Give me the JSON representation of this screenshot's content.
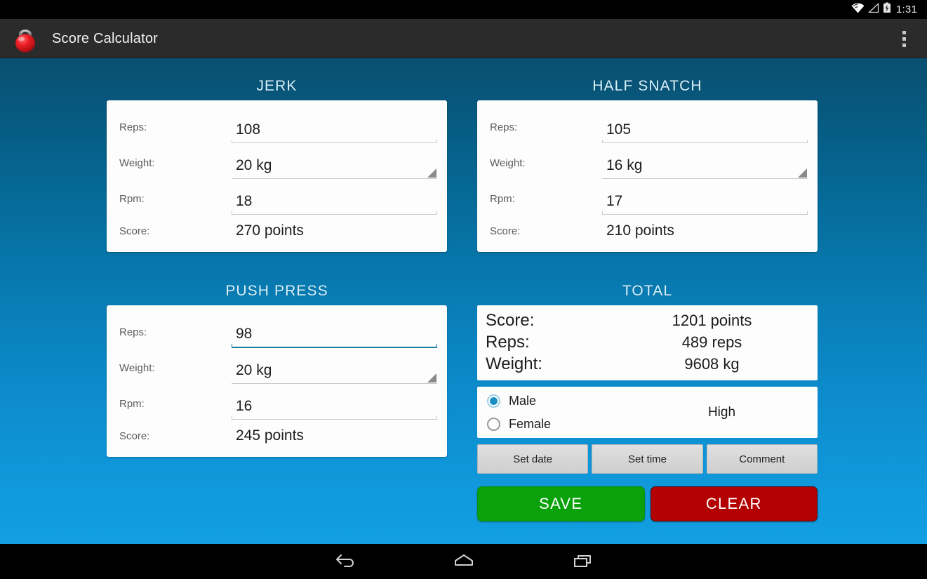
{
  "status_bar": {
    "clock": "1:31",
    "icons": [
      "wifi-icon",
      "signal-icon",
      "battery-charging-icon"
    ]
  },
  "action_bar": {
    "app_icon": "kettlebell-icon",
    "title": "Score Calculator",
    "overflow_icon": "overflow-menu-icon"
  },
  "theme": {
    "background_top": "#0a4f70",
    "background_bottom": "#139fe3",
    "section_title_color": "#d9f2fc",
    "focus_accent": "#1b7a9e",
    "radio_accent": "#1c8fc4",
    "save_color": "#0ba10b",
    "clear_color": "#b30000"
  },
  "labels": {
    "reps": "Reps:",
    "weight": "Weight:",
    "rpm": "Rpm:",
    "score": "Score:"
  },
  "exercises": [
    {
      "title": "JERK",
      "reps": "108",
      "weight": "20 kg",
      "rpm": "18",
      "score": "270 points",
      "reps_focused": false
    },
    {
      "title": "HALF SNATCH",
      "reps": "105",
      "weight": "16 kg",
      "rpm": "17",
      "score": "210 points",
      "reps_focused": false
    },
    {
      "title": "PUSH PRESS",
      "reps": "98",
      "weight": "20 kg",
      "rpm": "16",
      "score": "245 points",
      "reps_focused": true
    }
  ],
  "total": {
    "title": "TOTAL",
    "rows": [
      {
        "label": "Score:",
        "value": "1201 points"
      },
      {
        "label": "Reps:",
        "value": "489 reps"
      },
      {
        "label": "Weight:",
        "value": "9608 kg"
      }
    ],
    "gender": {
      "male_label": "Male",
      "female_label": "Female",
      "selected": "Male"
    },
    "level": "High",
    "meta_buttons": [
      "Set date",
      "Set time",
      "Comment"
    ],
    "save_label": "SAVE",
    "clear_label": "CLEAR"
  },
  "nav_bar": {
    "back": "back-icon",
    "home": "home-icon",
    "recents": "recents-icon"
  }
}
